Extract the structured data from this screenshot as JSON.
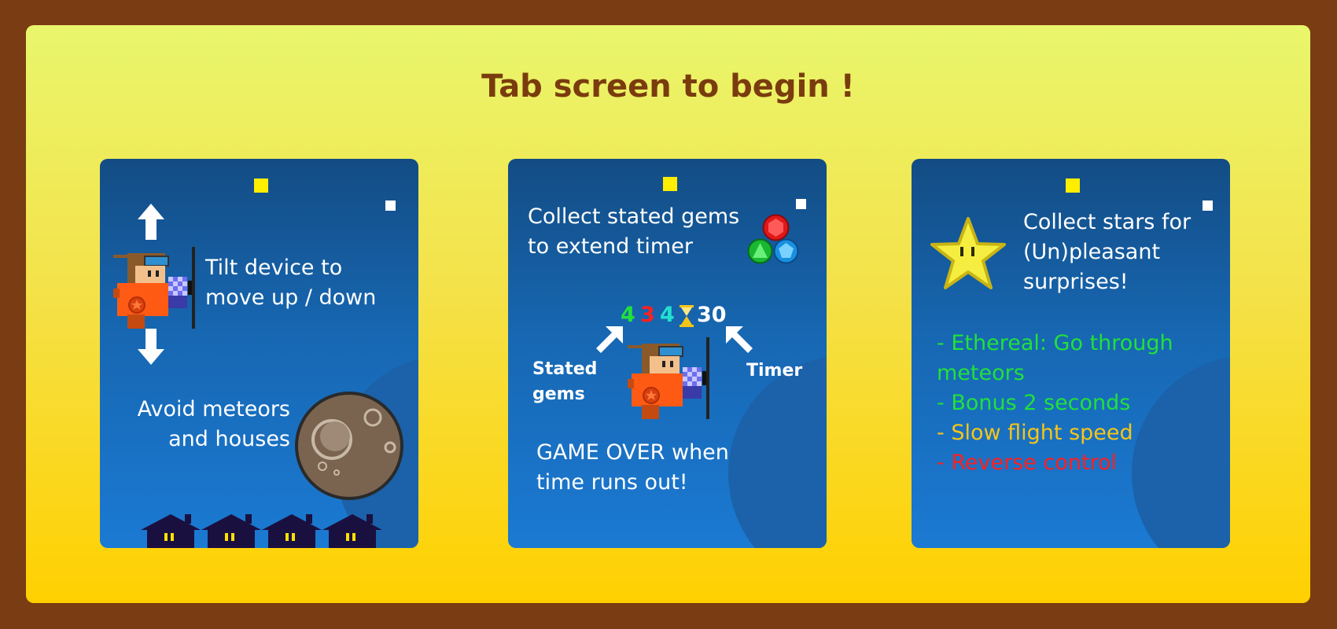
{
  "title": "Tab screen to begin !",
  "colors": {
    "frame": "#7a3c12",
    "title": "#7a3c0e",
    "card": "#1767b2",
    "green": "#22e03a",
    "yellow": "#f5c518",
    "red": "#ff2020",
    "cyan": "#22e0d0"
  },
  "card1": {
    "tilt_line1": "Tilt device to",
    "tilt_line2": "move up / down",
    "avoid_line1": "Avoid meteors",
    "avoid_line2": "and houses"
  },
  "card2": {
    "collect_line1": "Collect stated gems",
    "collect_line2": "to extend timer",
    "gem_count_green": "4",
    "gem_count_red": "3",
    "gem_count_cyan": "4",
    "timer_value": "30",
    "stated_label_line1": "Stated",
    "stated_label_line2": "gems",
    "timer_label": "Timer",
    "gameover_line1": "GAME OVER when",
    "gameover_line2": "time runs out!"
  },
  "card3": {
    "stars_line1": "Collect stars for",
    "stars_line2": "(Un)pleasant",
    "stars_line3": "surprises!",
    "effect1_line1": "- Ethereal: Go through",
    "effect1_line2": "meteors",
    "effect2": "- Bonus 2 seconds",
    "effect3": "- Slow flight speed",
    "effect4": "- Reverse control"
  }
}
